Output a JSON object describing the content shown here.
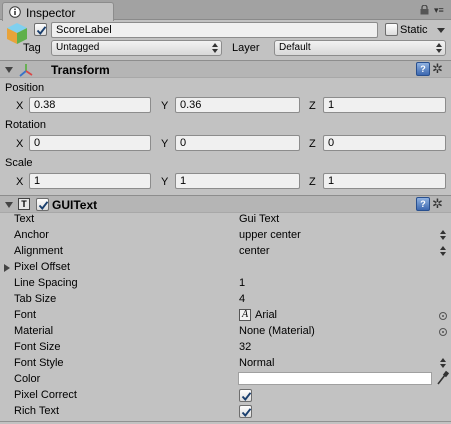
{
  "window": {
    "tab_title": "Inspector"
  },
  "gameobject": {
    "active": true,
    "name": "ScoreLabel",
    "static_label": "Static",
    "static_checked": false,
    "tag_label": "Tag",
    "tag_value": "Untagged",
    "layer_label": "Layer",
    "layer_value": "Default"
  },
  "transform": {
    "title": "Transform",
    "position_label": "Position",
    "rotation_label": "Rotation",
    "scale_label": "Scale",
    "axis_x": "X",
    "axis_y": "Y",
    "axis_z": "Z",
    "position": {
      "x": "0.38",
      "y": "0.36",
      "z": "1"
    },
    "rotation": {
      "x": "0",
      "y": "0",
      "z": "0"
    },
    "scale": {
      "x": "1",
      "y": "1",
      "z": "1"
    }
  },
  "guitext": {
    "enabled": true,
    "title": "GUIText",
    "props": {
      "text": {
        "label": "Text",
        "value": "Gui Text"
      },
      "anchor": {
        "label": "Anchor",
        "value": "upper center"
      },
      "alignment": {
        "label": "Alignment",
        "value": "center"
      },
      "pixel_offset": {
        "label": "Pixel Offset"
      },
      "line_spacing": {
        "label": "Line Spacing",
        "value": "1"
      },
      "tab_size": {
        "label": "Tab Size",
        "value": "4"
      },
      "font": {
        "label": "Font",
        "value": "Arial"
      },
      "material": {
        "label": "Material",
        "value": "None (Material)"
      },
      "font_size": {
        "label": "Font Size",
        "value": "32"
      },
      "font_style": {
        "label": "Font Style",
        "value": "Normal"
      },
      "color": {
        "label": "Color",
        "value": "#ffffff"
      },
      "pixel_correct": {
        "label": "Pixel Correct",
        "checked": true
      },
      "rich_text": {
        "label": "Rich Text",
        "checked": true
      }
    }
  },
  "icons": {
    "tab": "inspector-icon",
    "lock": "lock-icon",
    "menu": "window-menu-icon",
    "gameobject": "cube-icon",
    "transform": "transform-axes-icon",
    "guitext": "guitext-component-icon",
    "help": "help-book-icon",
    "settings": "gear-icon",
    "eyedropper": "eyedropper-icon"
  }
}
